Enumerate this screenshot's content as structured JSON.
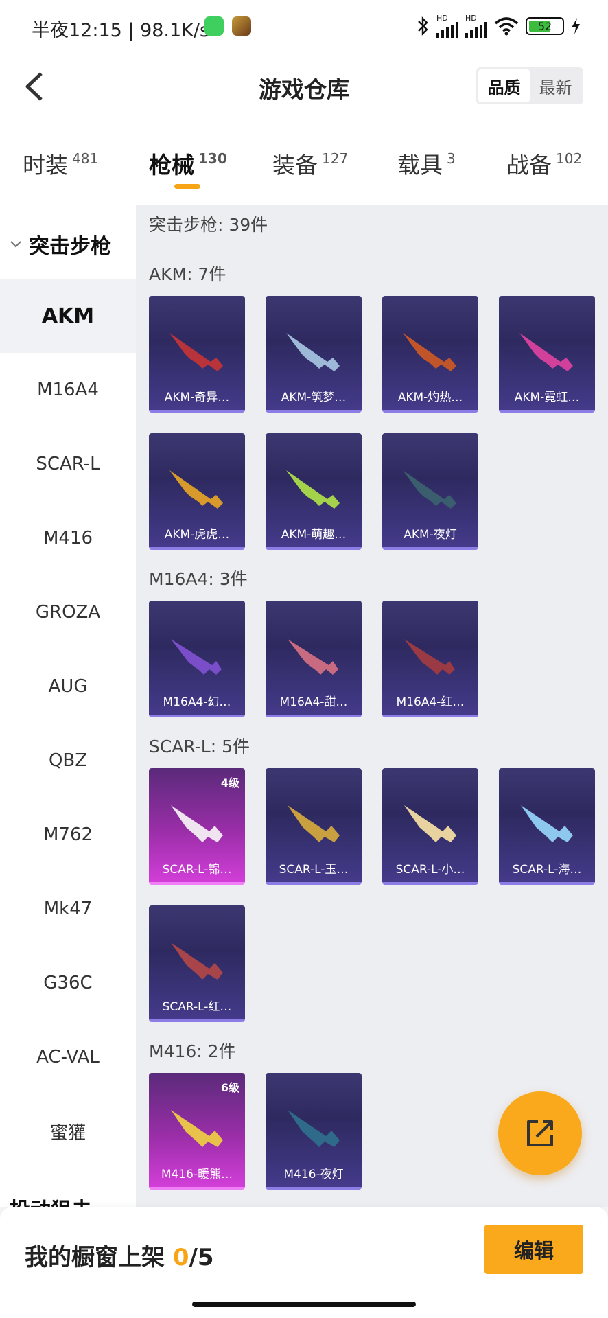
{
  "status_bar": {
    "time": "半夜12:15 | 98.1K/s",
    "signal_1": "HD",
    "signal_2": "HD",
    "battery": "52"
  },
  "header": {
    "title": "游戏仓库",
    "sort_options": [
      "品质",
      "最新"
    ],
    "sort_selected": "品质"
  },
  "tabs": [
    {
      "label": "时装",
      "count": "481"
    },
    {
      "label": "枪械",
      "count": "130"
    },
    {
      "label": "装备",
      "count": "127"
    },
    {
      "label": "载具",
      "count": "3"
    },
    {
      "label": "战备",
      "count": "102"
    }
  ],
  "active_tab": "枪械",
  "sidebar": {
    "category": "突击步枪",
    "items": [
      "AKM",
      "M16A4",
      "SCAR-L",
      "M416",
      "GROZA",
      "AUG",
      "QBZ",
      "M762",
      "Mk47",
      "G36C",
      "AC-VAL",
      "蜜獾"
    ],
    "active_item": "AKM",
    "next_category": "投动狙击"
  },
  "content": {
    "category_header": "突击步枪: 39件",
    "groups": [
      {
        "label": "AKM: 7件",
        "items": [
          {
            "name": "AKM-奇异…"
          },
          {
            "name": "AKM-筑梦…"
          },
          {
            "name": "AKM-灼热…"
          },
          {
            "name": "AKM-霓虹…"
          },
          {
            "name": "AKM-虎虎…"
          },
          {
            "name": "AKM-萌趣…"
          },
          {
            "name": "AKM-夜灯"
          }
        ]
      },
      {
        "label": "M16A4: 3件",
        "items": [
          {
            "name": "M16A4-幻…"
          },
          {
            "name": "M16A4-甜…"
          },
          {
            "name": "M16A4-红…"
          }
        ]
      },
      {
        "label": "SCAR-L: 5件",
        "items": [
          {
            "name": "SCAR-L-锦…",
            "level": "4级"
          },
          {
            "name": "SCAR-L-玉…"
          },
          {
            "name": "SCAR-L-小…"
          },
          {
            "name": "SCAR-L-海…"
          },
          {
            "name": "SCAR-L-红…"
          }
        ]
      },
      {
        "label": "M416: 2件",
        "items": [
          {
            "name": "M416-暖熊…",
            "level": "6级"
          },
          {
            "name": "M416-夜灯"
          }
        ]
      }
    ]
  },
  "footer": {
    "shelf_label": "我的橱窗上架",
    "shelf_count": "0",
    "shelf_total": "/5",
    "edit_label": "编辑"
  },
  "colors": {
    "accent": "#f9a91b",
    "card_blue": "#2e2a60",
    "card_purple": "#9a2ea8"
  },
  "icons": {
    "back": "chevron-left-icon",
    "share": "share-external-icon"
  }
}
